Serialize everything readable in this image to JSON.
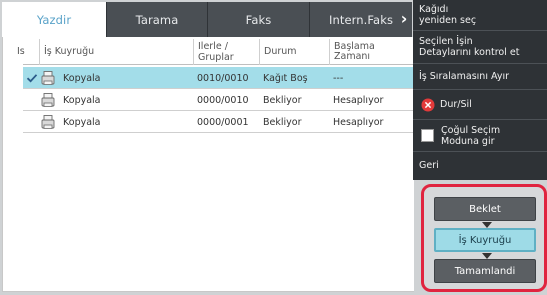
{
  "tabs": [
    {
      "label": "Yazdir",
      "active": true
    },
    {
      "label": "Tarama",
      "active": false
    },
    {
      "label": "Faks",
      "active": false
    },
    {
      "label": "Intern.Faks",
      "active": false
    }
  ],
  "table": {
    "headers": {
      "is": "Is",
      "queue": "İş Kuyruğu",
      "progress": "Ilerle / Gruplar",
      "status": "Durum",
      "start_time": "Başlama\nZamanı"
    },
    "rows": [
      {
        "name": "Kopyala",
        "progress": "0010/0010",
        "status": "Kağıt Boş",
        "start_time": "---",
        "selected": true
      },
      {
        "name": "Kopyala",
        "progress": "0000/0010",
        "status": "Bekliyor",
        "start_time": "Hesaplıyor",
        "selected": false
      },
      {
        "name": "Kopyala",
        "progress": "0000/0001",
        "status": "Bekliyor",
        "start_time": "Hesaplıyor",
        "selected": false
      }
    ]
  },
  "menu": {
    "items": [
      {
        "label": "Kağıdı\nyeniden seç",
        "icon": ""
      },
      {
        "label": "Seçilen İşin\nDetaylarını kontrol et",
        "icon": ""
      },
      {
        "label": "İş Sıralamasını Ayır",
        "icon": ""
      },
      {
        "label": "Dur/Sil",
        "icon": "stop-icon"
      },
      {
        "label": "Çoğul Seçim\nModuna gir",
        "icon": "checkbox-icon"
      },
      {
        "label": "Geri",
        "icon": ""
      }
    ]
  },
  "controls": {
    "buttons": [
      {
        "label": "Beklet",
        "active": false
      },
      {
        "label": "İş Kuyruğu",
        "active": true
      },
      {
        "label": "Tamamlandi",
        "active": false
      }
    ]
  },
  "colors": {
    "accent_selected": "#a3dde9",
    "highlight_border": "#e0243f",
    "tab_active_text": "#5aa3c9",
    "menu_bg": "#2e3236"
  }
}
